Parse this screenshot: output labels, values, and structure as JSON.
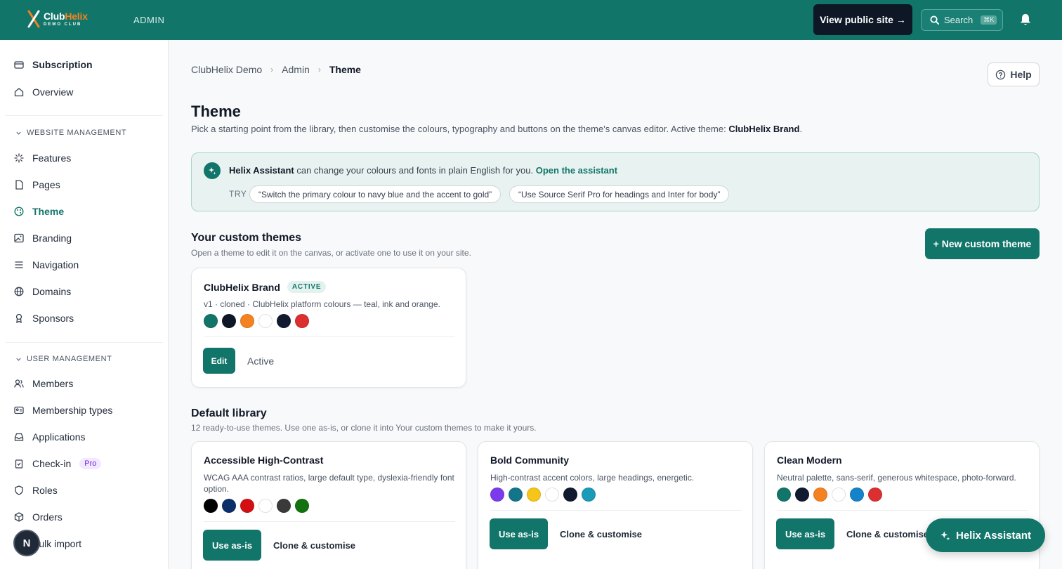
{
  "header": {
    "logo_name_a": "Club",
    "logo_name_b": "Helix",
    "logo_sub": "DEMO CLUB",
    "admin_label": "ADMIN",
    "view_public": "View public site →",
    "search_label": "Search",
    "search_shortcut": "⌘K"
  },
  "sidebar": {
    "subscription": "Subscription",
    "overview": "Overview",
    "website_section": "WEBSITE MANAGEMENT",
    "features": "Features",
    "pages": "Pages",
    "theme": "Theme",
    "branding": "Branding",
    "navigation": "Navigation",
    "domains": "Domains",
    "sponsors": "Sponsors",
    "user_section": "USER MANAGEMENT",
    "members": "Members",
    "membership_types": "Membership types",
    "applications": "Applications",
    "checkin": "Check-in",
    "pro_badge": "Pro",
    "roles": "Roles",
    "orders": "Orders",
    "bulk_import": "Bulk import",
    "avatar_letter": "N"
  },
  "breadcrumb": [
    "ClubHelix Demo",
    "Admin",
    "Theme"
  ],
  "help_label": "Help",
  "page": {
    "title": "Theme",
    "subtitle_pre": "Pick a starting point from the library, then customise the colours, typography and buttons on the theme's canvas editor. Active theme: ",
    "subtitle_active": "ClubHelix Brand",
    "subtitle_end": "."
  },
  "assistant": {
    "name": "Helix Assistant",
    "text": " can change your colours and fonts in plain English for you. ",
    "link": "Open the assistant",
    "try_label": "TRY",
    "chips": [
      "“Switch the primary colour to navy blue and the accent to gold”",
      "“Use Source Serif Pro for headings and Inter for body”"
    ]
  },
  "custom_themes": {
    "title": "Your custom themes",
    "subtitle": "Open a theme to edit it on the canvas, or activate one to use it on your site.",
    "new_button": "+ New custom theme",
    "card": {
      "name": "ClubHelix Brand",
      "badge": "ACTIVE",
      "desc": "v1 · cloned · ClubHelix platform colours — teal, ink and orange.",
      "colors": [
        "#12756a",
        "#0e1726",
        "#f58220",
        "#ffffff",
        "#111a2e",
        "#dc2f2f"
      ],
      "edit_label": "Edit",
      "status_label": "Active"
    }
  },
  "library": {
    "title": "Default library",
    "subtitle": "12 ready-to-use themes. Use one as-is, or clone it into Your custom themes to make it yours.",
    "use_label": "Use as-is",
    "clone_label": "Clone & customise",
    "cards": [
      {
        "name": "Accessible High-Contrast",
        "desc_line1": "WCAG AAA contrast ratios, large default type, dyslexia-friendly font",
        "desc_line2": "option.",
        "colors": [
          "#000000",
          "#0b2f6b",
          "#d40f14",
          "#ffffff",
          "#3a3a3a",
          "#12720f"
        ]
      },
      {
        "name": "Bold Community",
        "desc_line1": "High-contrast accent colors, large headings, energetic.",
        "desc_line2": "",
        "colors": [
          "#7c3aed",
          "#12758a",
          "#f5c518",
          "#ffffff",
          "#111a2e",
          "#1a9bb8"
        ]
      },
      {
        "name": "Clean Modern",
        "desc_line1": "Neutral palette, sans-serif, generous whitespace, photo-forward.",
        "desc_line2": "",
        "colors": [
          "#12756a",
          "#111a2e",
          "#f58220",
          "#ffffff",
          "#1483c9",
          "#dc2f2f"
        ]
      }
    ]
  },
  "fab_label": "Helix Assistant",
  "colors": {
    "brand_teal": "#12756a",
    "ink": "#0e1726",
    "accent_orange": "#f58220"
  }
}
